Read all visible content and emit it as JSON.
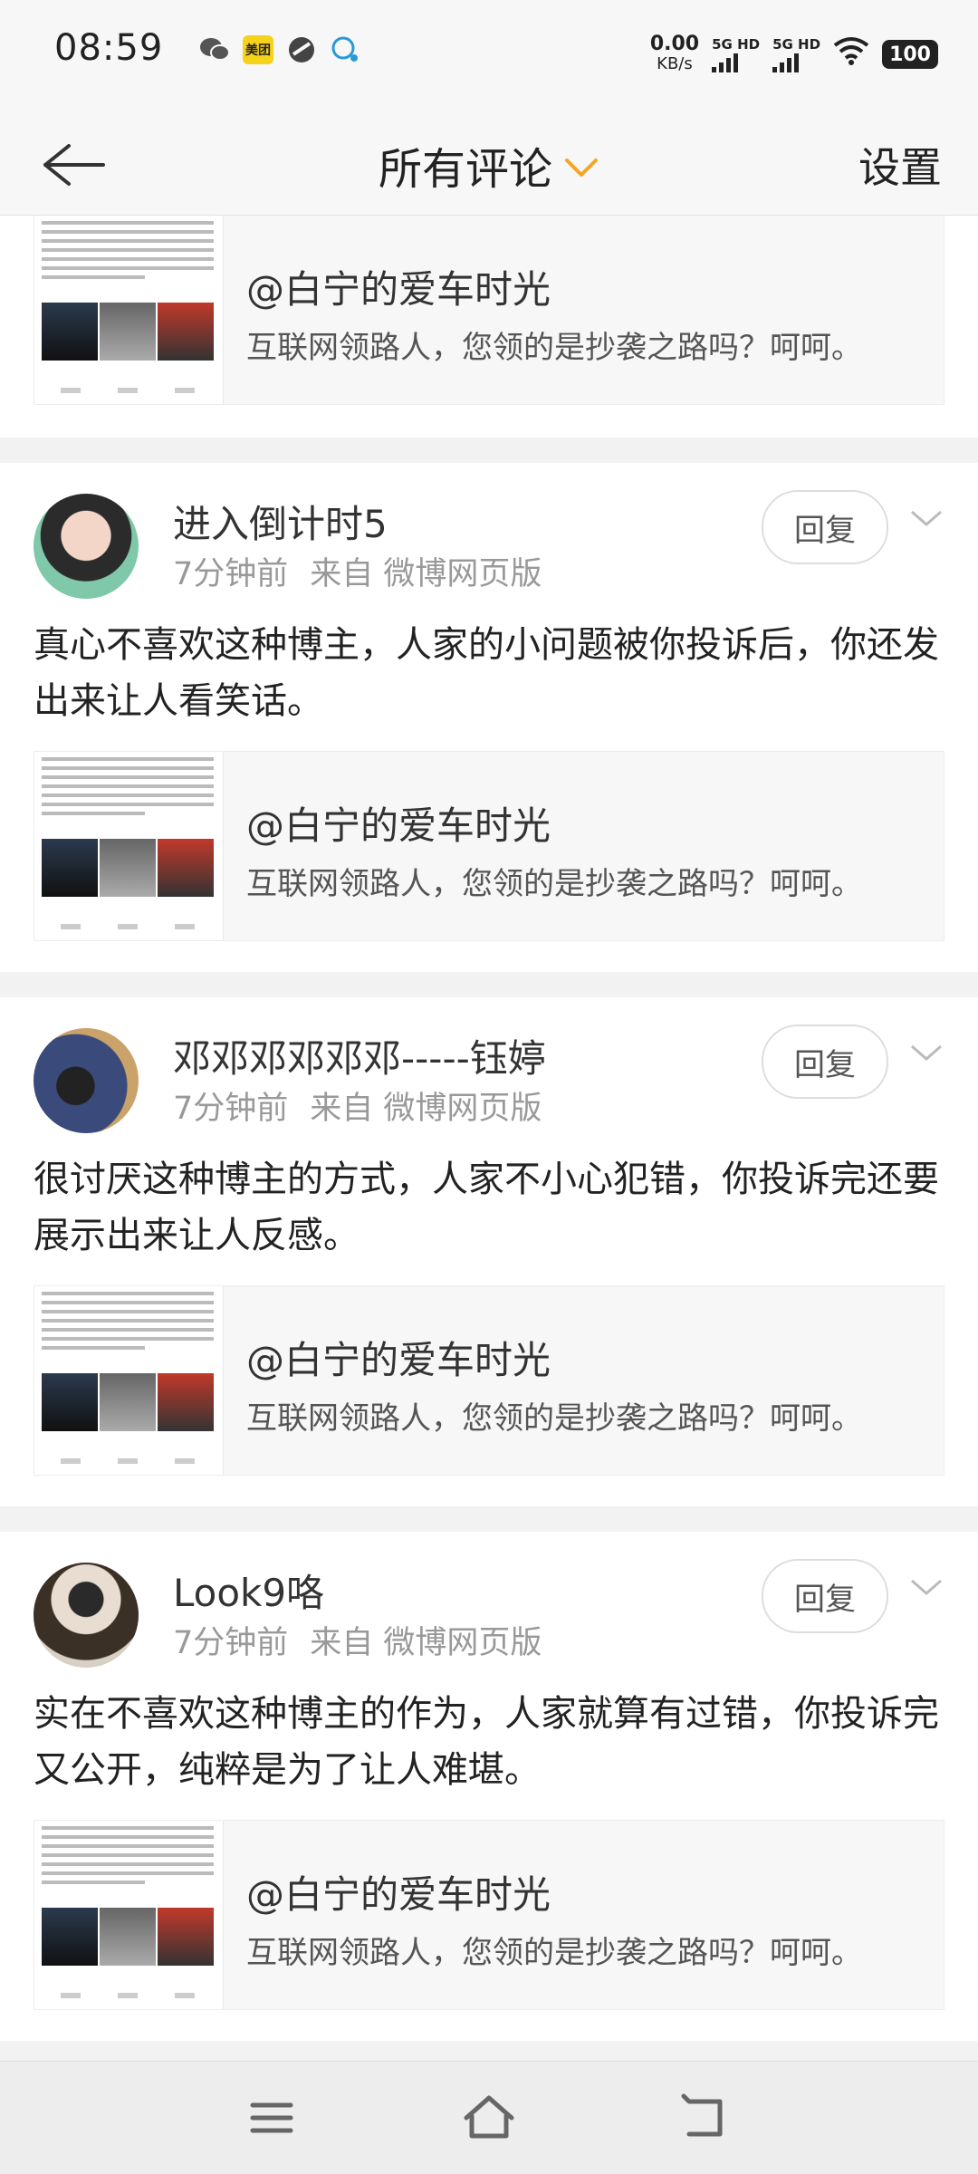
{
  "status_bar": {
    "time": "08:59",
    "app_icons": [
      "wechat-icon",
      "meituan-icon",
      "app-icon",
      "message-icon"
    ],
    "meituan_label": "美团",
    "speed_value": "0.00",
    "speed_unit": "KB/s",
    "sim1_label": "5G HD",
    "sim2_label": "5G HD",
    "battery": "100"
  },
  "nav": {
    "title": "所有评论",
    "settings_label": "设置"
  },
  "quote_post": {
    "user": "@白宁的爱车时光",
    "text": "互联网领路人，您领的是抄袭之路吗？呵呵。"
  },
  "comments": [
    {
      "name": "进入倒计时5",
      "time": "7分钟前",
      "source": "来自 微博网页版",
      "reply_label": "回复",
      "text": "真心不喜欢这种博主，人家的小问题被你投诉后，你还发出来让人看笑话。"
    },
    {
      "name": "邓邓邓邓邓邓-----钰婷",
      "time": "7分钟前",
      "source": "来自 微博网页版",
      "reply_label": "回复",
      "text": "很讨厌这种博主的方式，人家不小心犯错，你投诉完还要展示出来让人反感。"
    },
    {
      "name": "Look9咯",
      "time": "7分钟前",
      "source": "来自 微博网页版",
      "reply_label": "回复",
      "text": "实在不喜欢这种博主的作为，人家就算有过错，你投诉完又公开，纯粹是为了让人难堪。"
    }
  ],
  "colors": {
    "accent": "#f5a623",
    "background": "#f2f2f2",
    "card": "#ffffff"
  }
}
